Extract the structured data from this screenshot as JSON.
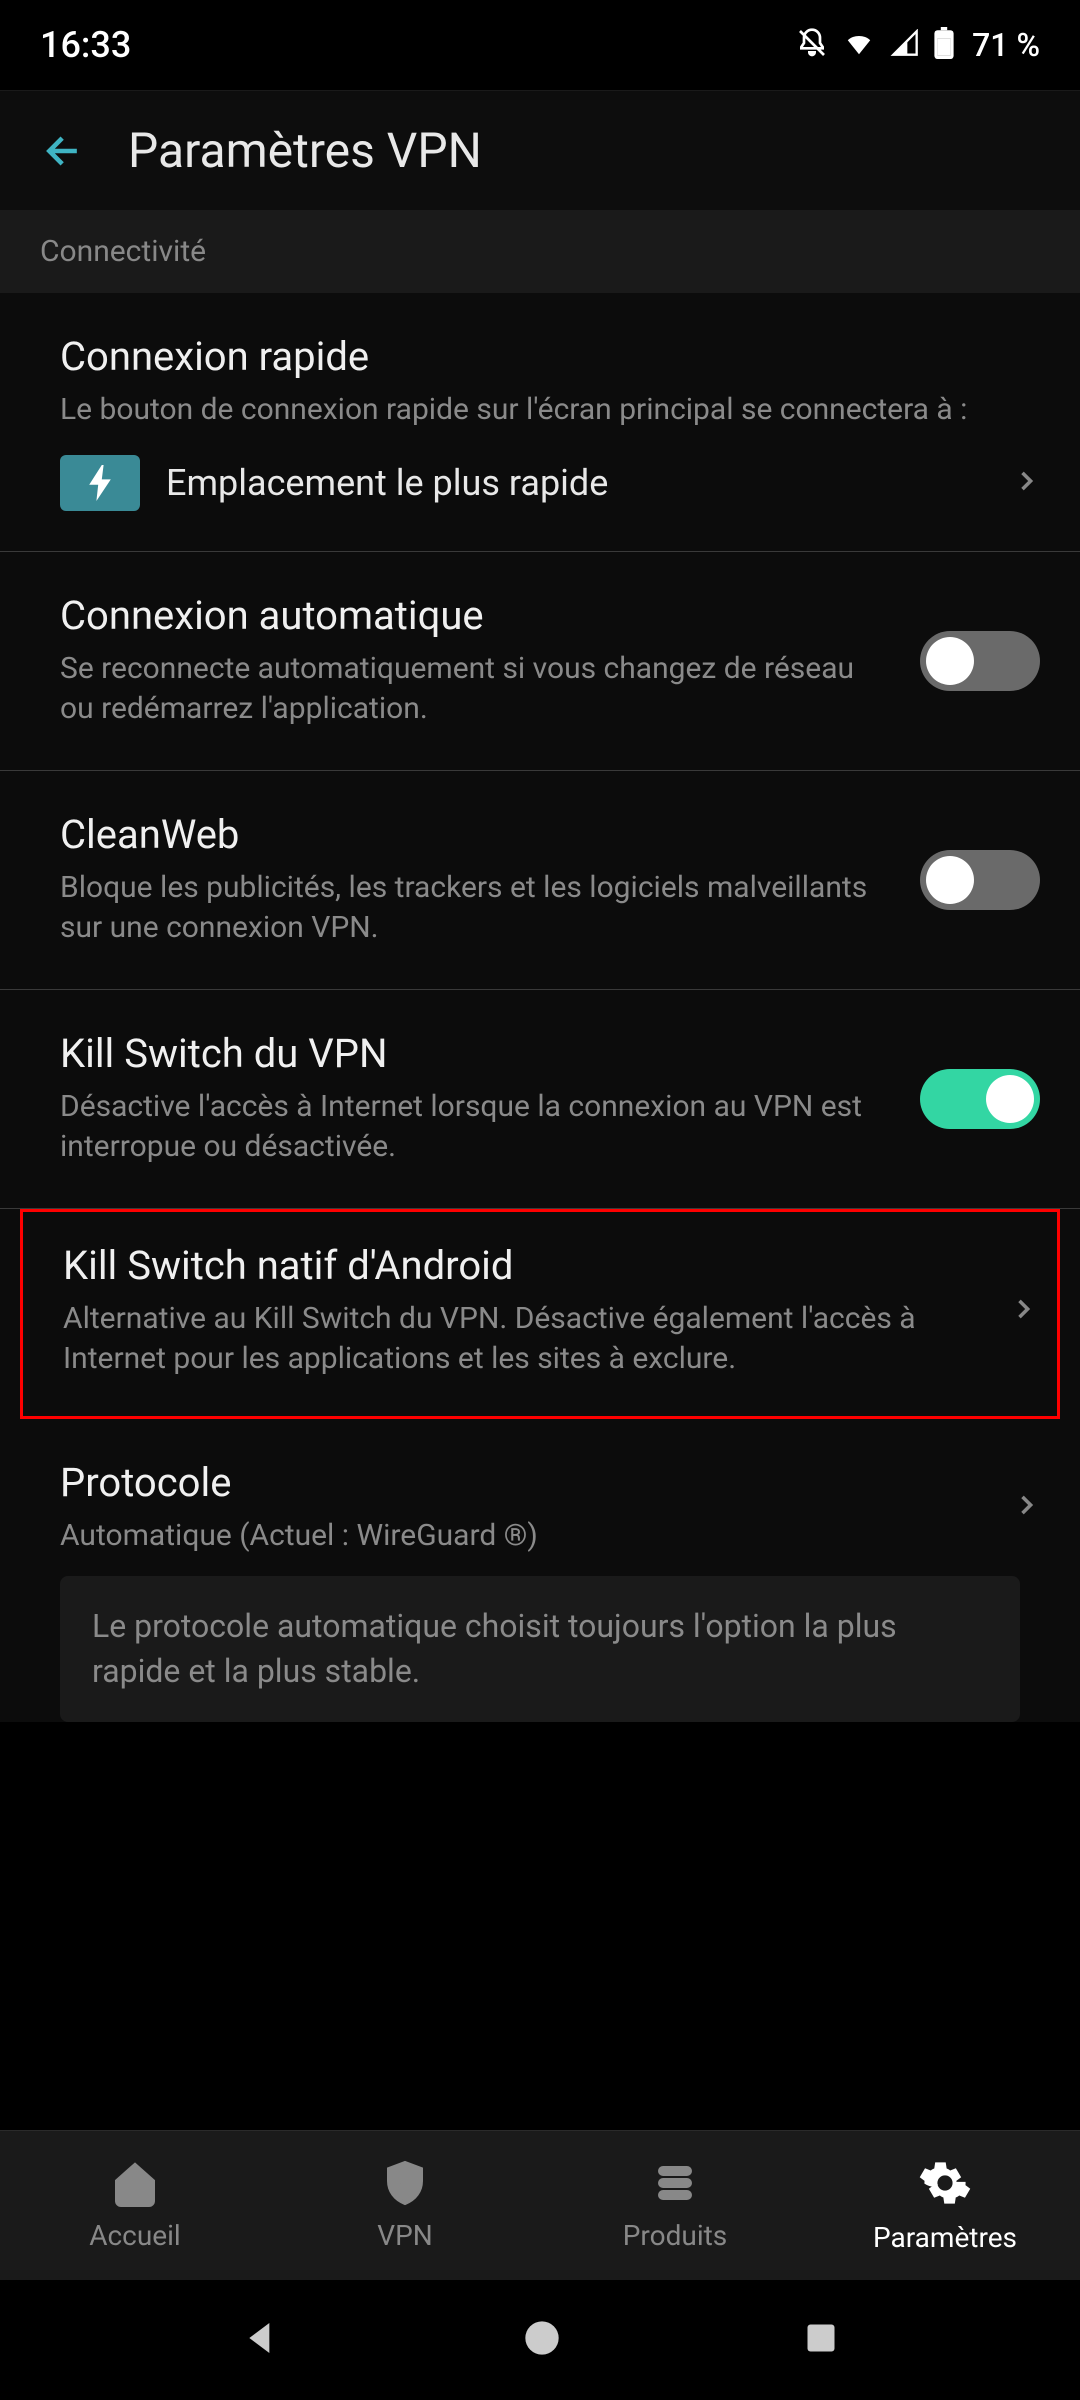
{
  "status": {
    "time": "16:33",
    "battery": "71 %"
  },
  "header": {
    "title": "Paramètres VPN"
  },
  "section": {
    "connectivity": "Connectivité"
  },
  "quickconnect": {
    "title": "Connexion rapide",
    "desc": "Le bouton de connexion rapide sur l'écran principal se connectera à :",
    "option": "Emplacement le plus rapide"
  },
  "autoconnect": {
    "title": "Connexion automatique",
    "desc": "Se reconnecte automatiquement si vous changez de réseau ou redémarrez l'application.",
    "enabled": false
  },
  "cleanweb": {
    "title": "CleanWeb",
    "desc": "Bloque les publicités, les trackers et les logiciels malveillants sur une connexion VPN.",
    "enabled": false
  },
  "killswitch": {
    "title": "Kill Switch du VPN",
    "desc": "Désactive l'accès à Internet lorsque la connexion au VPN est interropue ou désactivée.",
    "enabled": true
  },
  "native_killswitch": {
    "title": "Kill Switch natif d'Android",
    "desc": "Alternative au Kill Switch du VPN. Désactive également l'accès à Internet pour les applications et les sites à exclure."
  },
  "protocol": {
    "title": "Protocole",
    "desc": "Automatique (Actuel : WireGuard ®)",
    "hint": "Le protocole automatique choisit toujours l'option la plus rapide et la plus stable."
  },
  "nav": {
    "home": "Accueil",
    "vpn": "VPN",
    "products": "Produits",
    "settings": "Paramètres"
  }
}
